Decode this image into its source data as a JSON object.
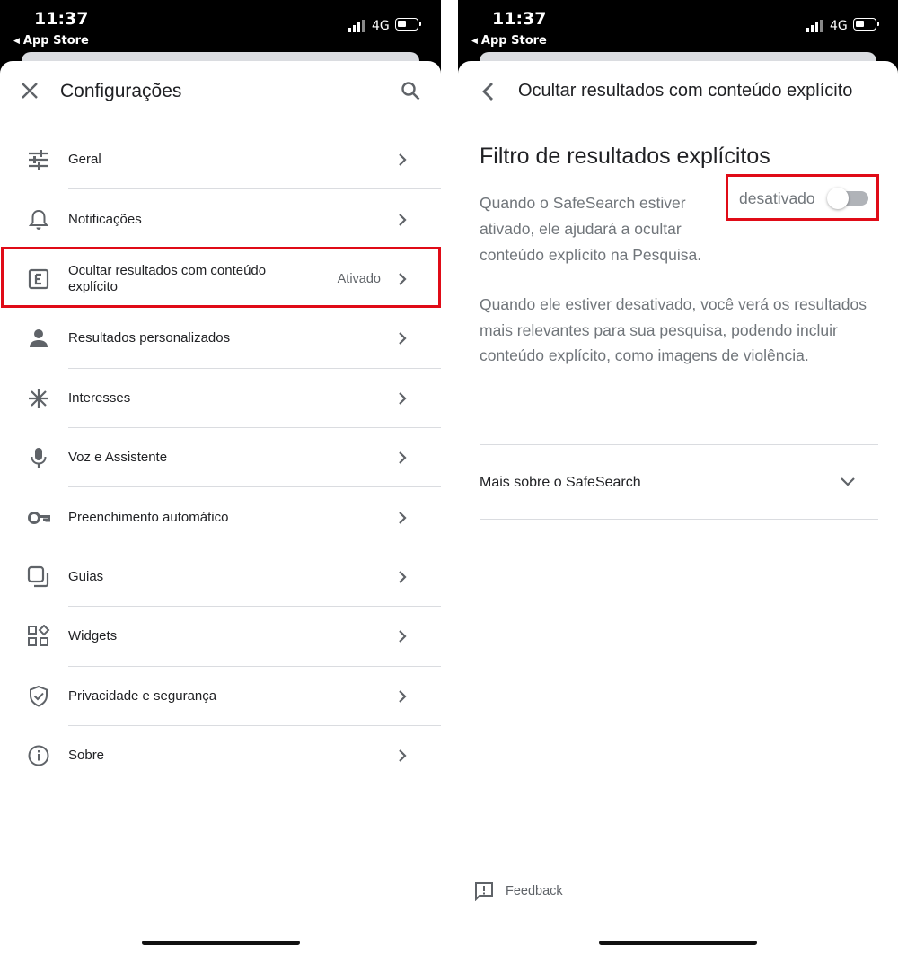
{
  "status_bar": {
    "time": "11:37",
    "back_app": "App Store",
    "network": "4G"
  },
  "settings": {
    "title": "Configurações",
    "items": [
      {
        "label": "Geral",
        "icon": "tune-icon",
        "value": ""
      },
      {
        "label": "Notificações",
        "icon": "bell-icon",
        "value": ""
      },
      {
        "label": "Ocultar resultados com conteúdo explícito",
        "icon": "explicit-icon",
        "value": "Ativado"
      },
      {
        "label": "Resultados personalizados",
        "icon": "person-icon",
        "value": ""
      },
      {
        "label": "Interesses",
        "icon": "asterisk-icon",
        "value": ""
      },
      {
        "label": "Voz e Assistente",
        "icon": "microphone-icon",
        "value": ""
      },
      {
        "label": "Preenchimento automático",
        "icon": "key-icon",
        "value": ""
      },
      {
        "label": "Guias",
        "icon": "tabs-icon",
        "value": ""
      },
      {
        "label": "Widgets",
        "icon": "widgets-icon",
        "value": ""
      },
      {
        "label": "Privacidade e segurança",
        "icon": "shield-icon",
        "value": ""
      },
      {
        "label": "Sobre",
        "icon": "info-icon",
        "value": ""
      }
    ]
  },
  "safesearch": {
    "header_title": "Ocultar resultados com conteúdo explícito",
    "filter_title": "Filtro de resultados explícitos",
    "toggle_label": "desativado",
    "toggle_on": false,
    "description_on": "Quando o SafeSearch estiver ativado, ele ajudará a ocultar conteúdo explícito na Pesquisa.",
    "description_off": "Quando ele estiver desativado, você verá os resultados mais relevantes para sua pesquisa, podendo incluir conteúdo explícito, como imagens de violência.",
    "more_label": "Mais sobre o SafeSearch",
    "feedback_label": "Feedback"
  },
  "colors": {
    "highlight": "#e00b17",
    "text_primary": "#202124",
    "text_secondary": "#70757a",
    "divider": "#dadce0"
  }
}
